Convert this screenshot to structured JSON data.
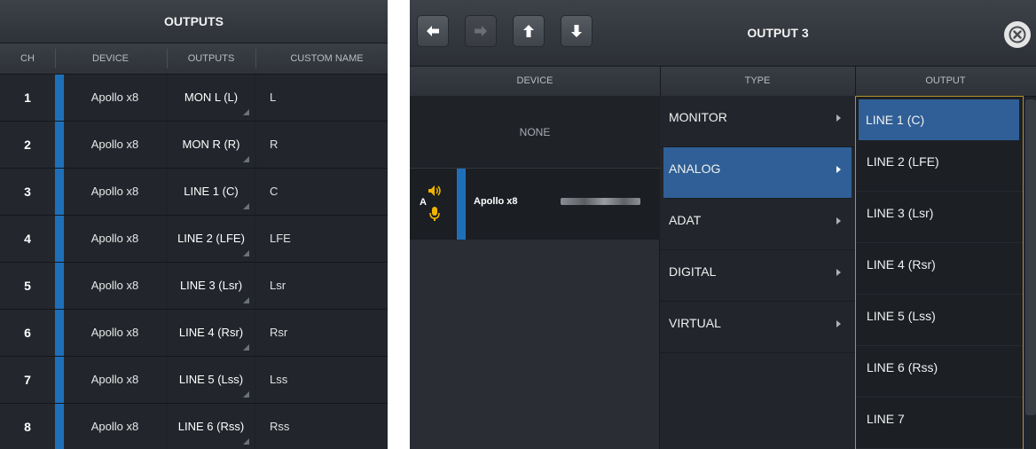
{
  "left": {
    "title": "OUTPUTS",
    "columns": {
      "ch": "CH",
      "device": "DEVICE",
      "outputs": "OUTPUTS",
      "custom_name": "CUSTOM NAME"
    },
    "rows": [
      {
        "ch": "1",
        "device": "Apollo x8",
        "output": "MON L (L)",
        "name": "L"
      },
      {
        "ch": "2",
        "device": "Apollo x8",
        "output": "MON R (R)",
        "name": "R"
      },
      {
        "ch": "3",
        "device": "Apollo x8",
        "output": "LINE 1 (C)",
        "name": "C"
      },
      {
        "ch": "4",
        "device": "Apollo x8",
        "output": "LINE 2 (LFE)",
        "name": "LFE"
      },
      {
        "ch": "5",
        "device": "Apollo x8",
        "output": "LINE 3 (Lsr)",
        "name": "Lsr"
      },
      {
        "ch": "6",
        "device": "Apollo x8",
        "output": "LINE 4 (Rsr)",
        "name": "Rsr"
      },
      {
        "ch": "7",
        "device": "Apollo x8",
        "output": "LINE 5 (Lss)",
        "name": "Lss"
      },
      {
        "ch": "8",
        "device": "Apollo x8",
        "output": "LINE 6 (Rss)",
        "name": "Rss"
      }
    ]
  },
  "right": {
    "title": "OUTPUT 3",
    "toolbar": {
      "icons": [
        "arrow-left-icon",
        "arrow-right-icon",
        "arrow-up-icon",
        "arrow-down-icon",
        "close-icon"
      ]
    },
    "columns": {
      "device": "DEVICE",
      "type": "TYPE",
      "output": "OUTPUT"
    },
    "devices": {
      "none_label": "NONE",
      "device_letter": "A",
      "device_name": "Apollo x8"
    },
    "types": [
      {
        "label": "MONITOR",
        "selected": false
      },
      {
        "label": "ANALOG",
        "selected": true
      },
      {
        "label": "ADAT",
        "selected": false
      },
      {
        "label": "DIGITAL",
        "selected": false
      },
      {
        "label": "VIRTUAL",
        "selected": false
      }
    ],
    "outputs": [
      {
        "label": "LINE 1 (C)",
        "selected": true
      },
      {
        "label": "LINE 2 (LFE)",
        "selected": false
      },
      {
        "label": "LINE 3 (Lsr)",
        "selected": false
      },
      {
        "label": "LINE 4 (Rsr)",
        "selected": false
      },
      {
        "label": "LINE 5 (Lss)",
        "selected": false
      },
      {
        "label": "LINE 6 (Rss)",
        "selected": false
      },
      {
        "label": "LINE 7",
        "selected": false
      }
    ]
  },
  "colors": {
    "accent_blue": "#1f6fb8",
    "selection_blue": "#2f5f96",
    "focus_border": "#b59132",
    "speaker_yellow": "#f0b400"
  }
}
